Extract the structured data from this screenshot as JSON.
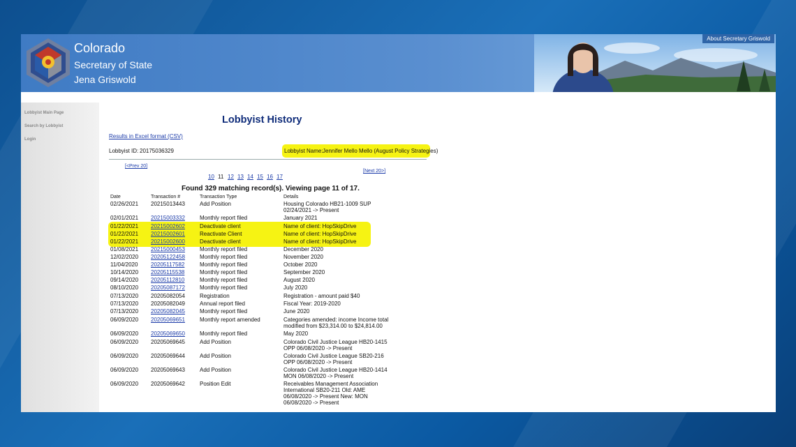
{
  "header": {
    "state": "Colorado",
    "office": "Secretary of State",
    "official": "Jena Griswold",
    "about_link": "About Secretary Griswold"
  },
  "sidebar": {
    "items": [
      "Lobbyist Main Page",
      "Search by Lobbyist",
      "Login"
    ]
  },
  "page": {
    "title": "Lobbyist History",
    "excel_link": "Results in Excel format (CSV)",
    "lobbyist_id_label": "Lobbyist ID:",
    "lobbyist_id": "20175036329",
    "lobbyist_name_label": "Lobbyist Name:",
    "lobbyist_name": "Jennifer Mello Mello (August Policy Strategies)",
    "prev_link": "[<Prev 20]",
    "next_link": "[Next 20>]",
    "pages": [
      "10",
      "11",
      "12",
      "13",
      "14",
      "15",
      "16",
      "17"
    ],
    "current_page": "11",
    "summary": "Found 329 matching record(s).  Viewing page 11 of 17."
  },
  "table": {
    "headers": [
      "Date",
      "Transaction #",
      "Transaction Type",
      "Details"
    ],
    "rows": [
      {
        "date": "02/26/2021",
        "txn": "20215013443",
        "link": false,
        "type": "Add Position",
        "details": [
          "Housing Colorado HB21-1009 SUP",
          " 02/24/2021 -> Present"
        ],
        "highlight": false
      },
      {
        "date": "02/01/2021",
        "txn": "20215003332",
        "link": true,
        "type": "Monthly report filed",
        "details": [
          "January 2021"
        ],
        "highlight": false
      },
      {
        "date": "01/22/2021",
        "txn": "20215002602",
        "link": true,
        "type": "Deactivate client",
        "details": [
          "Name of client: HopSkipDrive"
        ],
        "highlight": true
      },
      {
        "date": "01/22/2021",
        "txn": "20215002601",
        "link": true,
        "type": "Reactivate Client",
        "details": [
          "Name of client: HopSkipDrive"
        ],
        "highlight": true
      },
      {
        "date": "01/22/2021",
        "txn": "20215002600",
        "link": true,
        "type": "Deactivate client",
        "details": [
          "Name of client: HopSkipDrive"
        ],
        "highlight": true
      },
      {
        "date": "01/08/2021",
        "txn": "20215000453",
        "link": true,
        "type": "Monthly report filed",
        "details": [
          "December 2020"
        ],
        "highlight": false
      },
      {
        "date": "12/02/2020",
        "txn": "20205122458",
        "link": true,
        "type": "Monthly report filed",
        "details": [
          "November 2020"
        ],
        "highlight": false
      },
      {
        "date": "11/04/2020",
        "txn": "20205117582",
        "link": true,
        "type": "Monthly report filed",
        "details": [
          "October 2020"
        ],
        "highlight": false
      },
      {
        "date": "10/14/2020",
        "txn": "20205115538",
        "link": true,
        "type": "Monthly report filed",
        "details": [
          "September 2020"
        ],
        "highlight": false
      },
      {
        "date": "09/14/2020",
        "txn": "20205112810",
        "link": true,
        "type": "Monthly report filed",
        "details": [
          "August 2020"
        ],
        "highlight": false
      },
      {
        "date": "08/10/2020",
        "txn": "20205087172",
        "link": true,
        "type": "Monthly report filed",
        "details": [
          "July 2020"
        ],
        "highlight": false
      },
      {
        "date": "07/13/2020",
        "txn": "20205082054",
        "link": false,
        "type": "Registration",
        "details": [
          "Registration - amount paid $40"
        ],
        "highlight": false
      },
      {
        "date": "07/13/2020",
        "txn": "20205082049",
        "link": false,
        "type": "Annual report filed",
        "details": [
          "Fiscal Year: 2019-2020"
        ],
        "highlight": false
      },
      {
        "date": "07/13/2020",
        "txn": "20205082045",
        "link": true,
        "type": "Monthly report filed",
        "details": [
          "June 2020"
        ],
        "highlight": false
      },
      {
        "date": "06/09/2020",
        "txn": "20205069651",
        "link": true,
        "type": "Monthly report amended",
        "details": [
          "Categories amended: income Income total",
          " modified from $23,314.00 to $24,814.00"
        ],
        "highlight": false
      },
      {
        "date": "06/09/2020",
        "txn": "20205069650",
        "link": true,
        "type": "Monthly report filed",
        "details": [
          "May 2020"
        ],
        "highlight": false
      },
      {
        "date": "06/09/2020",
        "txn": "20205069645",
        "link": false,
        "type": "Add Position",
        "details": [
          "Colorado Civil Justice League HB20-1415",
          " OPP 06/08/2020 -> Present"
        ],
        "highlight": false
      },
      {
        "date": "06/09/2020",
        "txn": "20205069644",
        "link": false,
        "type": "Add Position",
        "details": [
          "Colorado Civil Justice League SB20-216",
          " OPP 06/08/2020 -> Present"
        ],
        "highlight": false
      },
      {
        "date": "06/09/2020",
        "txn": "20205069643",
        "link": false,
        "type": "Add Position",
        "details": [
          "Colorado Civil Justice League HB20-1414",
          " MON 06/08/2020 -> Present"
        ],
        "highlight": false
      },
      {
        "date": "06/09/2020",
        "txn": "20205069642",
        "link": false,
        "type": "Position Edit",
        "details": [
          "Receivables Management Association",
          " International SB20-211 Old: AME",
          " 06/08/2020 -> Present New: MON",
          " 06/08/2020 -> Present"
        ],
        "highlight": false
      }
    ]
  },
  "colors": {
    "banner": "#4a82c8",
    "title": "#0f2c7a",
    "link": "#1a3aa8",
    "highlight": "#f6f313"
  }
}
